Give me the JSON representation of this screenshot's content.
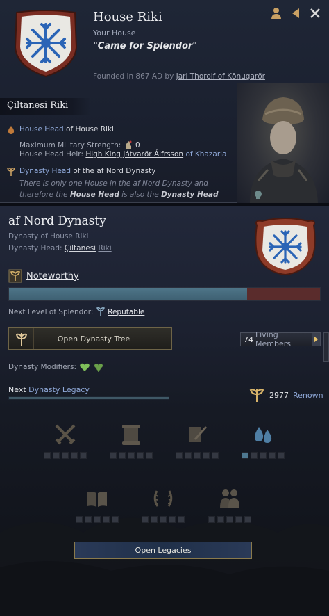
{
  "house": {
    "title": "House Riki",
    "subtitle": "Your House",
    "motto": "\"Came for Splendor\"",
    "founded_prefix": "Founded in 867 AD by",
    "founder": "Jarl Thorolf of Kōnugarðr",
    "holder_name": "Çiltanesi Riki",
    "head_label": "House Head",
    "head_rest": "of House Riki",
    "strength_label": "Maximum Military Strength:",
    "strength_value": "0",
    "heir_label": "House Head Heir:",
    "heir_name": "High King Játvarðr Álfrsson",
    "heir_suffix": "of Khazaria",
    "dyn_head_label": "Dynasty Head",
    "dyn_head_rest": "of the af Nord Dynasty",
    "note_line1": "There is only one House in the af Nord Dynasty and",
    "note_line2_a": "therefore the",
    "note_line2_b": "House Head",
    "note_line2_c": "is also the",
    "note_line2_d": "Dynasty Head"
  },
  "dynasty": {
    "title": "af Nord Dynasty",
    "subtitle": "Dynasty of House Riki",
    "head_label": "Dynasty Head:",
    "head_name": "Çiltanesi",
    "head_name2": "Riki",
    "splendor_level": "Noteworthy",
    "splendor_progress": 0.765,
    "next_level_label": "Next Level of Splendor:",
    "next_level": "Reputable",
    "tree_button": "Open Dynasty Tree",
    "members_count": "74",
    "members_label": "Living Members",
    "modifiers_label": "Dynasty Modifiers:",
    "legacy_next": "Next",
    "legacy_label": "Dynasty Legacy",
    "legacy_progress": 1.0,
    "renown_value": "2977",
    "renown_label": "Renown",
    "legacies_button": "Open Legacies"
  },
  "legacies": [
    {
      "icon": "crossed-swords-icon",
      "unlocked": 0
    },
    {
      "icon": "scroll-icon",
      "unlocked": 0
    },
    {
      "icon": "quill-icon",
      "unlocked": 0
    },
    {
      "icon": "blood-drops-icon",
      "unlocked": 1
    },
    {
      "icon": "book-icon",
      "unlocked": 0
    },
    {
      "icon": "laurel-icon",
      "unlocked": 0
    },
    {
      "icon": "family-icon",
      "unlocked": 0
    }
  ],
  "colors": {
    "splendor_fill": "#4e7588",
    "splendor_remaining": "#5a2c2c",
    "link_blue": "#8fa8d8",
    "crest_blue": "#2a64b6"
  }
}
